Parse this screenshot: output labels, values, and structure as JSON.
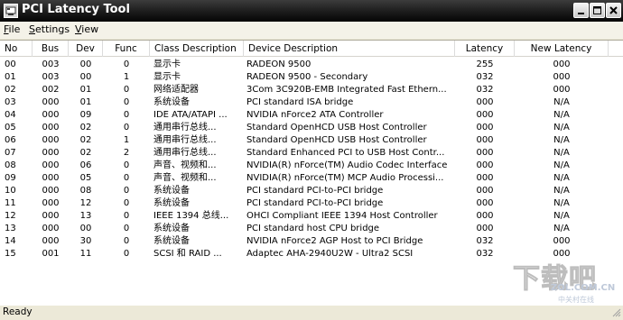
{
  "window": {
    "title": "PCI Latency Tool",
    "icon": "pci-tool-icon",
    "controls": [
      "minimize-icon",
      "maximize-icon",
      "close-icon"
    ]
  },
  "menu": {
    "items": [
      {
        "label": "File",
        "accel": "F",
        "rest": "ile"
      },
      {
        "label": "Settings",
        "accel": "S",
        "rest": "ettings"
      },
      {
        "label": "View",
        "accel": "V",
        "rest": "iew"
      }
    ]
  },
  "table": {
    "columns": [
      "No",
      "Bus",
      "Dev",
      "Func",
      "Class Description",
      "Device Description",
      "Latency",
      "New Latency"
    ],
    "rows": [
      [
        "00",
        "003",
        "00",
        "0",
        "显示卡",
        "RADEON 9500",
        "255",
        "000"
      ],
      [
        "01",
        "003",
        "00",
        "1",
        "显示卡",
        "RADEON 9500 - Secondary",
        "032",
        "000"
      ],
      [
        "02",
        "002",
        "01",
        "0",
        "网络适配器",
        "3Com 3C920B-EMB Integrated Fast Ethern...",
        "032",
        "000"
      ],
      [
        "03",
        "000",
        "01",
        "0",
        "系统设备",
        "PCI standard ISA bridge",
        "000",
        "N/A"
      ],
      [
        "04",
        "000",
        "09",
        "0",
        "IDE ATA/ATAPI ...",
        "NVIDIA nForce2 ATA Controller",
        "000",
        "N/A"
      ],
      [
        "05",
        "000",
        "02",
        "0",
        "通用串行总线...",
        "Standard OpenHCD USB Host Controller",
        "000",
        "N/A"
      ],
      [
        "06",
        "000",
        "02",
        "1",
        "通用串行总线...",
        "Standard OpenHCD USB Host Controller",
        "000",
        "N/A"
      ],
      [
        "07",
        "000",
        "02",
        "2",
        "通用串行总线...",
        "Standard Enhanced PCI to USB Host Contr...",
        "000",
        "N/A"
      ],
      [
        "08",
        "000",
        "06",
        "0",
        "声音、视频和...",
        "NVIDIA(R) nForce(TM) Audio Codec Interface",
        "000",
        "N/A"
      ],
      [
        "09",
        "000",
        "05",
        "0",
        "声音、视频和...",
        "NVIDIA(R) nForce(TM) MCP Audio Processi...",
        "000",
        "N/A"
      ],
      [
        "10",
        "000",
        "08",
        "0",
        "系统设备",
        "PCI standard PCI-to-PCI bridge",
        "000",
        "N/A"
      ],
      [
        "11",
        "000",
        "12",
        "0",
        "系统设备",
        "PCI standard PCI-to-PCI bridge",
        "000",
        "N/A"
      ],
      [
        "12",
        "000",
        "13",
        "0",
        "IEEE 1394 总线...",
        "OHCI Compliant IEEE 1394 Host Controller",
        "000",
        "N/A"
      ],
      [
        "13",
        "000",
        "00",
        "0",
        "系统设备",
        "PCI standard host CPU bridge",
        "000",
        "N/A"
      ],
      [
        "14",
        "000",
        "30",
        "0",
        "系统设备",
        "NVIDIA nForce2 AGP Host to PCI Bridge",
        "032",
        "000"
      ],
      [
        "15",
        "001",
        "11",
        "0",
        "SCSI 和 RAID ...",
        "Adaptec AHA-2940U2W - Ultra2 SCSI",
        "032",
        "000"
      ]
    ]
  },
  "status": {
    "text": "Ready"
  },
  "watermark": {
    "big": "下载吧",
    "site": "ZOL.COM.CN",
    "sub": "中关村在线"
  }
}
